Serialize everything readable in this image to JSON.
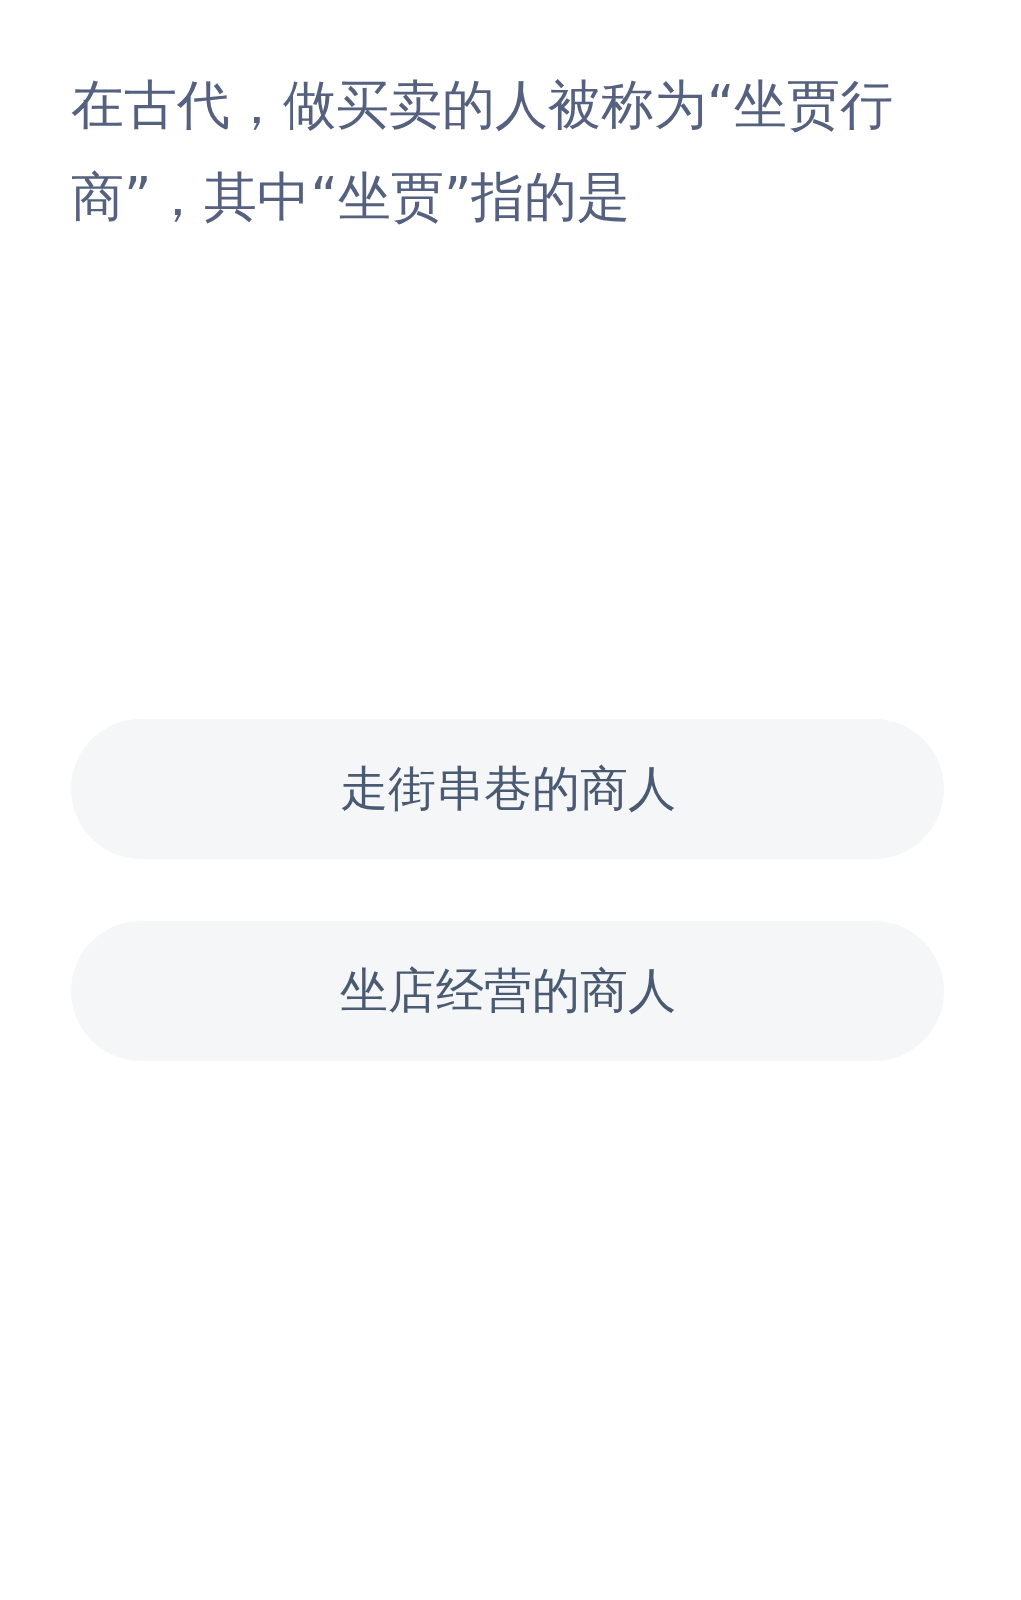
{
  "question": "在古代，做买卖的人被称为“坐贾行商”，其中“坐贾”指的是",
  "options": [
    {
      "label": "走街串巷的商人"
    },
    {
      "label": "坐店经营的商人"
    }
  ]
}
